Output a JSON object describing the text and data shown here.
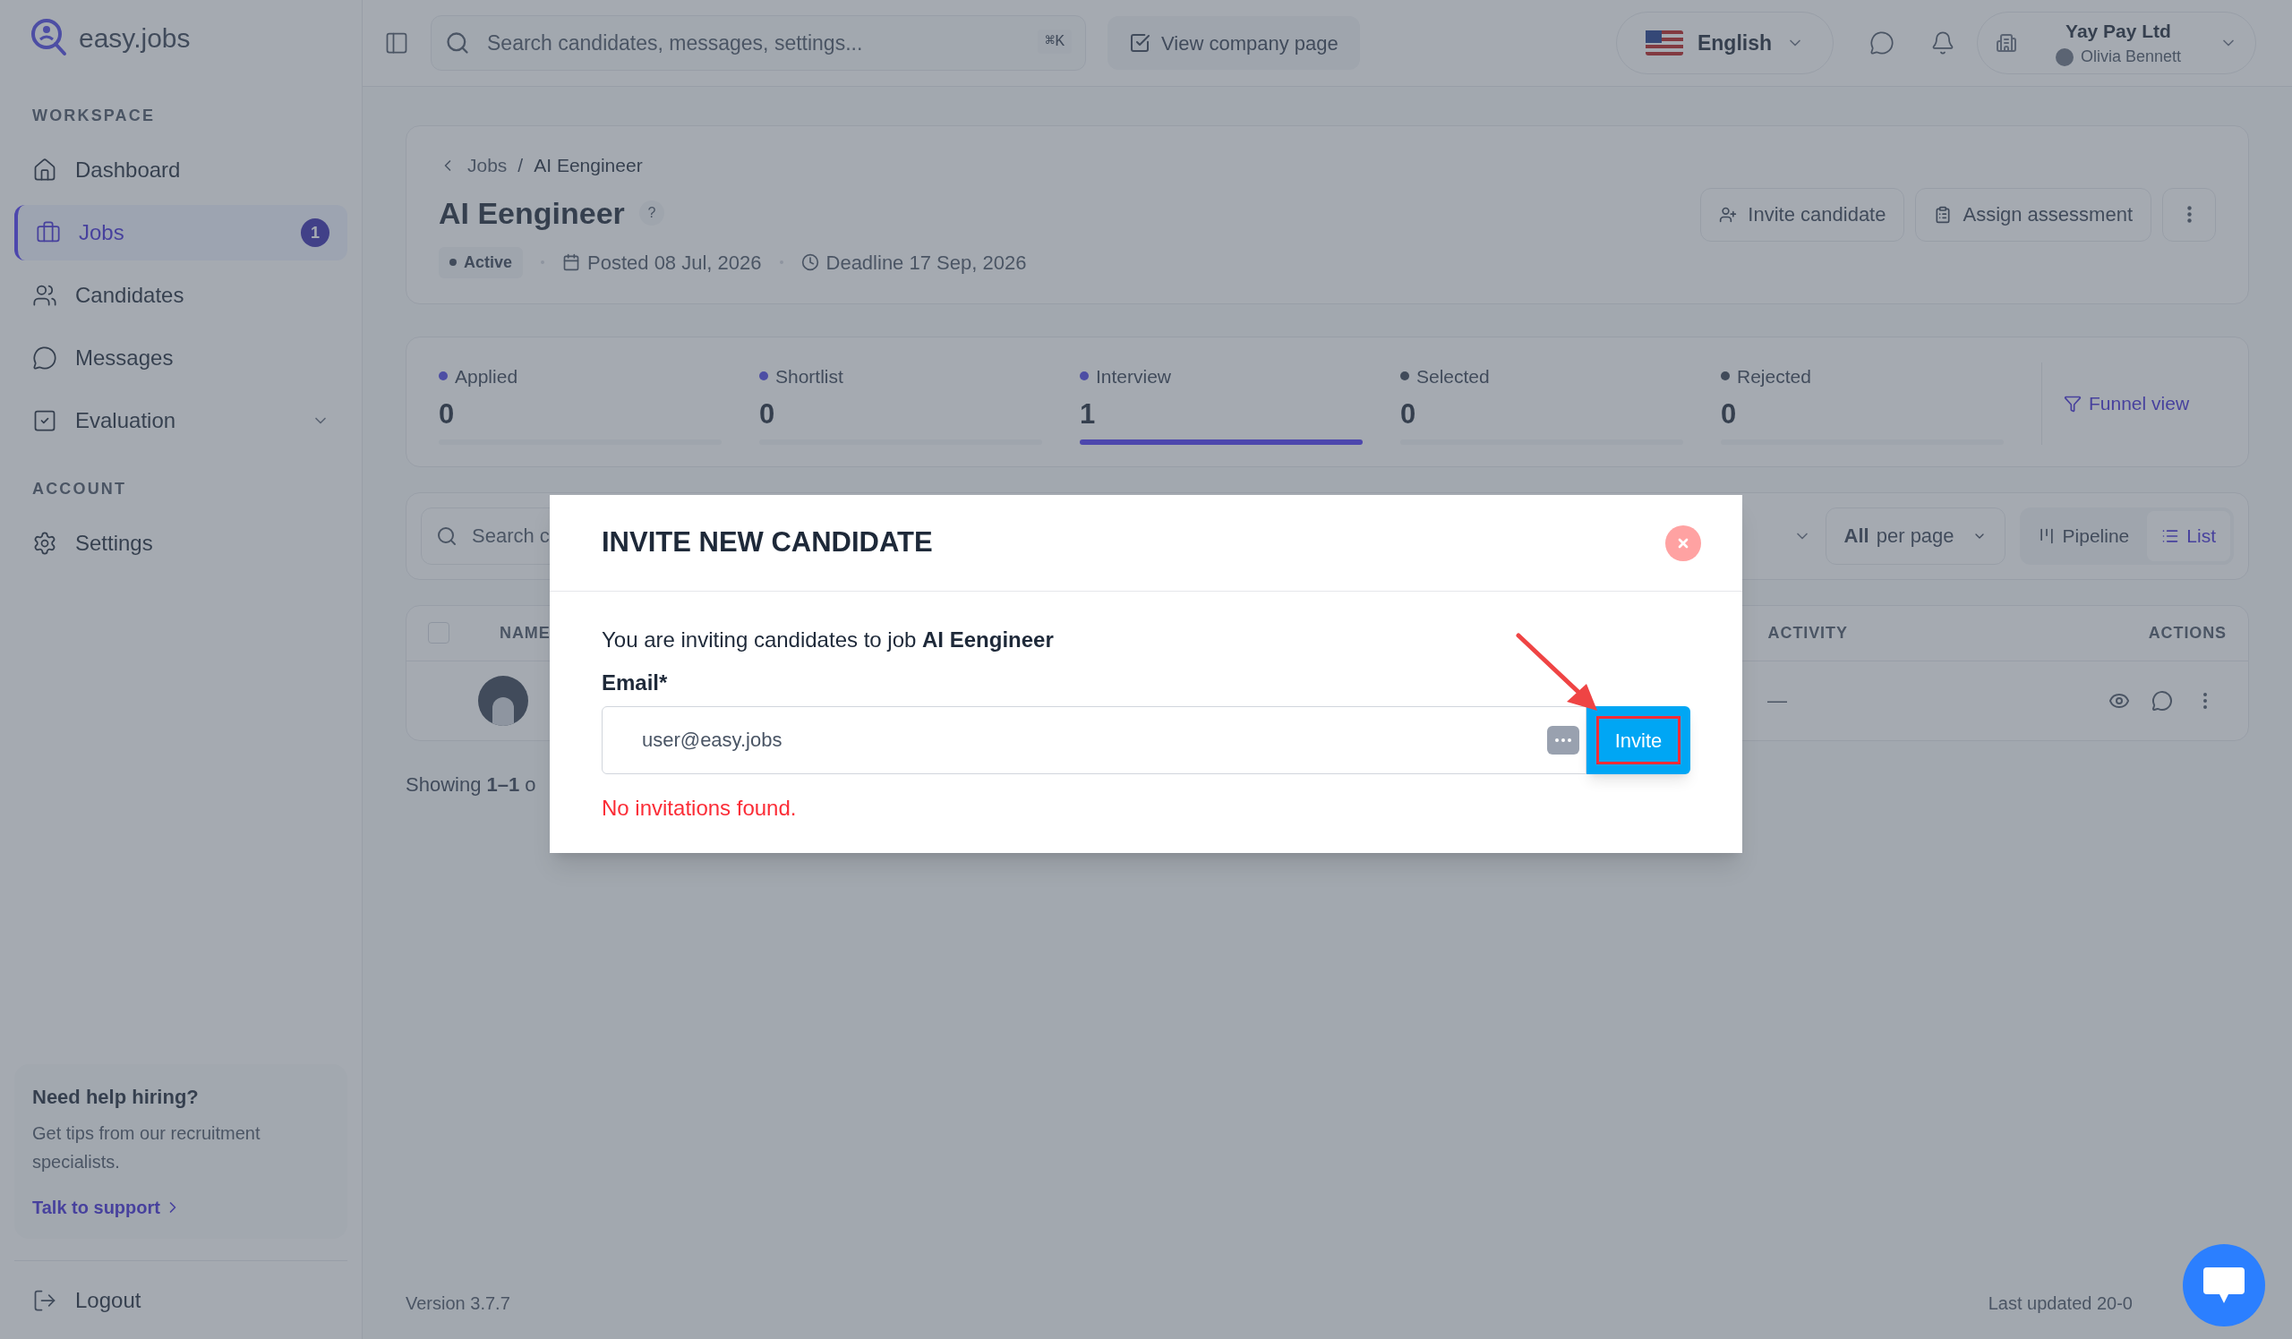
{
  "brand": {
    "name": "easy.jobs"
  },
  "topbar": {
    "search_placeholder": "Search candidates, messages, settings...",
    "shortcut": "⌘K",
    "company_page_button": "View company page",
    "language": "English",
    "company": "Yay Pay Ltd",
    "user": "Olivia Bennett"
  },
  "sidebar": {
    "sections": [
      {
        "heading": "WORKSPACE",
        "items": [
          {
            "label": "Dashboard",
            "selected": false
          },
          {
            "label": "Jobs",
            "selected": true,
            "badge": "1"
          },
          {
            "label": "Candidates",
            "selected": false
          },
          {
            "label": "Messages",
            "selected": false
          },
          {
            "label": "Evaluation",
            "selected": false
          }
        ]
      },
      {
        "heading": "ACCOUNT",
        "items": [
          {
            "label": "Settings",
            "selected": false
          }
        ]
      }
    ],
    "help": {
      "title": "Need help hiring?",
      "text": "Get tips from our recruitment specialists.",
      "link": "Talk to support"
    },
    "logout": "Logout"
  },
  "job": {
    "breadcrumb": [
      "Jobs",
      "/",
      "AI Eengineer"
    ],
    "title": "AI Eengineer",
    "help_mark": "?",
    "status": "Active",
    "posted": "Posted 08 Jul, 2026",
    "deadline": "Deadline 17 Sep, 2026",
    "actions": [
      "Invite candidate",
      "Assign assessment"
    ]
  },
  "stages": [
    {
      "label": "Applied",
      "count": "0",
      "color": "#4d4ea4",
      "selected": false
    },
    {
      "label": "Shortlist",
      "count": "0",
      "color": "#4d4ea4",
      "selected": false
    },
    {
      "label": "Interview",
      "count": "1",
      "color": "#4d4ea4",
      "selected": true
    },
    {
      "label": "Selected",
      "count": "0",
      "color": "#414b5a",
      "selected": false
    },
    {
      "label": "Rejected",
      "count": "0",
      "color": "#414b5a",
      "selected": false
    }
  ],
  "funnel_link": "Funnel view",
  "toolbar": {
    "search_placeholder": "Search c",
    "per_page_value": "All",
    "per_page_label": "per page",
    "views": [
      {
        "label": "Pipeline",
        "selected": false
      },
      {
        "label": "List",
        "selected": true
      }
    ]
  },
  "table": {
    "select_all": {
      "checked": false
    },
    "columns": [
      "NAME",
      "ACTIVITY",
      "ACTIONS"
    ],
    "rows": [
      {
        "activity": "—"
      }
    ]
  },
  "showing": "Showing **1–1** o",
  "footer": {
    "version": "Version 3.7.7",
    "updated": "Last updated 20-0"
  },
  "modal": {
    "title": "INVITE NEW CANDIDATE",
    "intro": "You are inviting candidates to job **AI Eengineer**",
    "email_label": "Email*",
    "email_value": "user@easy.jobs",
    "button": "Invite",
    "error": "No invitations found."
  }
}
